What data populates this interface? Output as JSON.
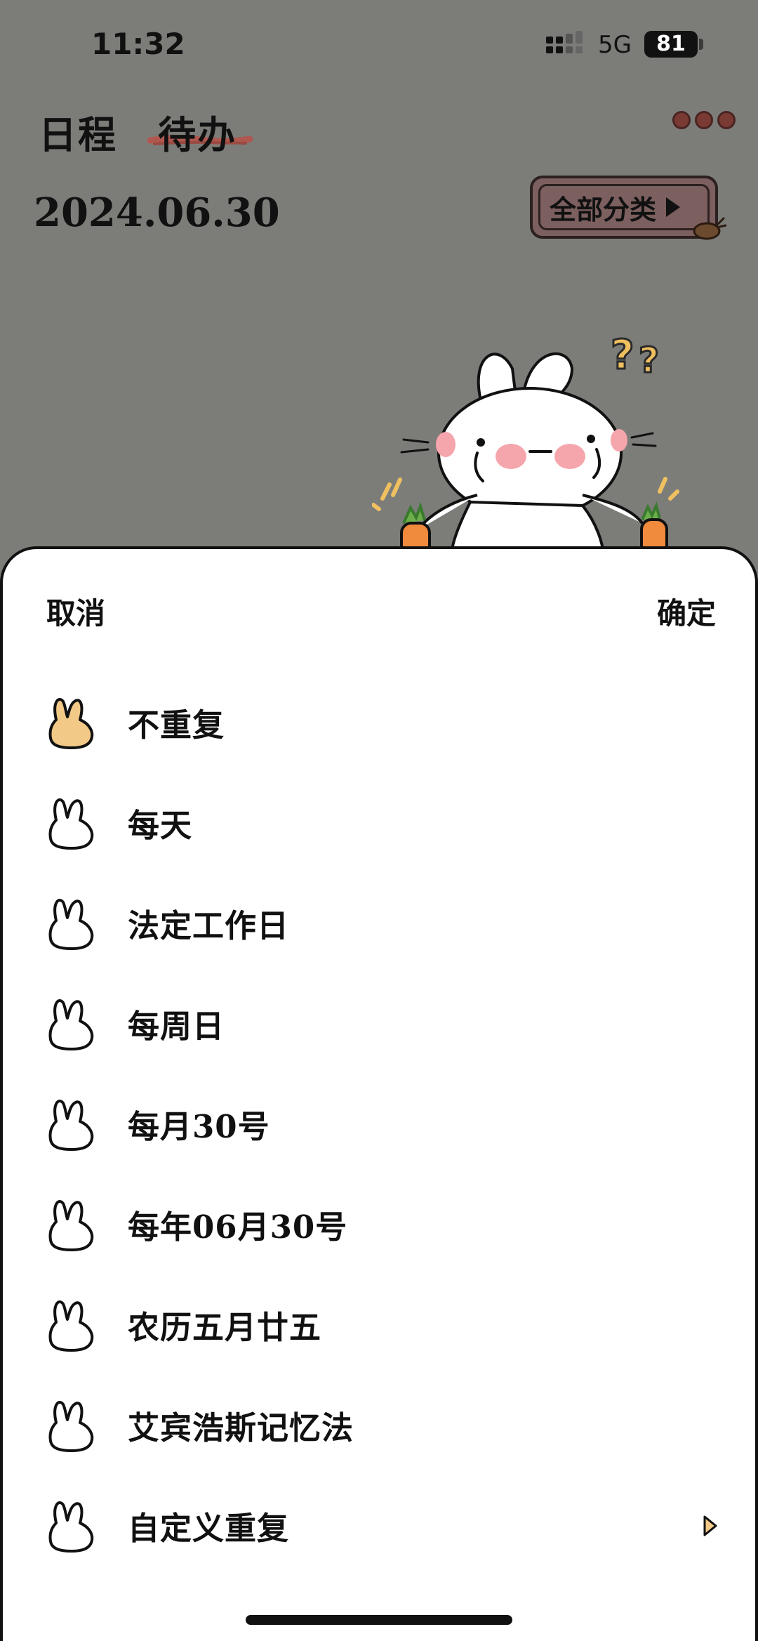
{
  "status_bar": {
    "time": "11:32",
    "network": "5G",
    "battery": "81"
  },
  "header": {
    "tabs": [
      {
        "label": "日程"
      },
      {
        "label": "待办"
      }
    ],
    "date": "2024.06.30",
    "category_button": "全部分类",
    "accent_color": "#b0584f"
  },
  "sheet": {
    "cancel": "取消",
    "confirm": "确定",
    "options": [
      {
        "label": "不重复",
        "selected": true
      },
      {
        "label": "每天",
        "selected": false
      },
      {
        "label": "法定工作日",
        "selected": false
      },
      {
        "label": "每周日",
        "selected": false
      },
      {
        "label": "每月30号",
        "selected": false
      },
      {
        "label": "每年06月30号",
        "selected": false
      },
      {
        "label": "农历五月廿五",
        "selected": false
      },
      {
        "label": "艾宾浩斯记忆法",
        "selected": false
      },
      {
        "label": "自定义重复",
        "selected": false,
        "has_submenu": true
      }
    ],
    "selected_color": "#f3c987"
  }
}
